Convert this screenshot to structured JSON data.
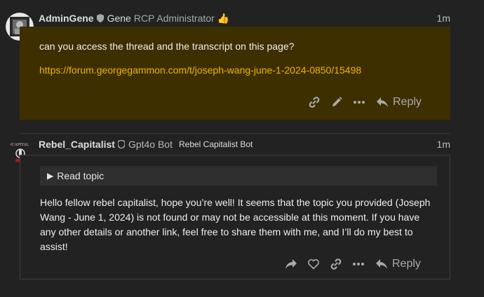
{
  "post1": {
    "username": "AdminGene",
    "full_name": "Gene",
    "user_title": "RCP Administrator",
    "title_emoji": "👍",
    "time": "1m",
    "text": "can you access the thread and the transcript on this page?",
    "link": "https://forum.georgegammon.com/t/joseph-wang-june-1-2024-0850/15498",
    "actions": {
      "icons": [
        "link-icon",
        "edit-icon",
        "more-icon"
      ],
      "reply_label": "Reply"
    }
  },
  "post2": {
    "username": "Rebel_Capitalist",
    "full_name": "Gpt4o Bot",
    "user_title": "Rebel Capitalist Bot",
    "time": "1m",
    "read_topic_label": "Read topic",
    "text": "Hello fellow rebel capitalist, hope you’re well! It seems that the topic you provided (Joseph Wang - June 1, 2024) is not found or may not be accessible at this moment. If you have any other details or another link, feel free to share them with me, and I’ll do my best to assist!",
    "actions": {
      "icons": [
        "share-icon",
        "like-icon",
        "link-icon",
        "more-icon"
      ],
      "reply_label": "Reply"
    }
  },
  "colors": {
    "background": "#222222",
    "highlight_post": "#3d2f00",
    "link": "#f0b400",
    "muted": "#a9a9a9"
  }
}
